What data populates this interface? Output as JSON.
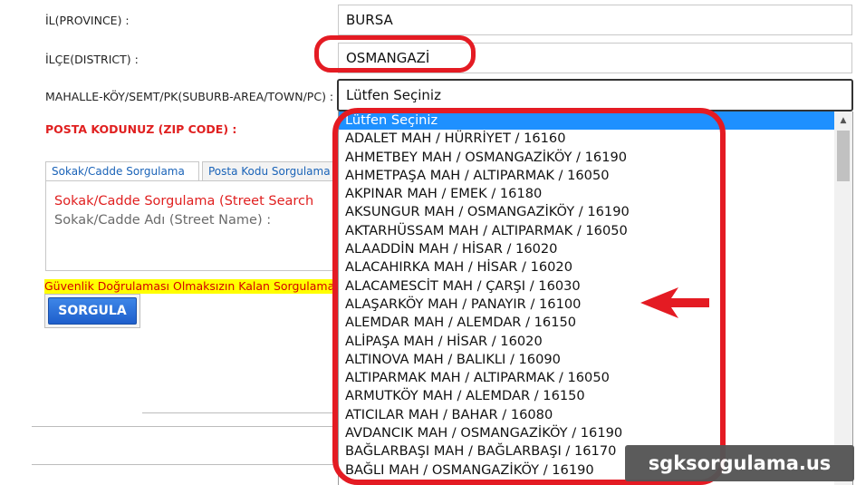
{
  "form": {
    "province_label": "İL(PROVINCE) :",
    "province_value": "BURSA",
    "district_label": "İLÇE(DISTRICT) :",
    "district_value": "OSMANGAZİ",
    "neighborhood_label": "MAHALLE-KÖY/SEMT/PK(SUBURB-AREA/TOWN/PC) :",
    "neighborhood_value": "Lütfen Seçiniz",
    "zip_label": "POSTA KODUNUZ (ZIP CODE) :"
  },
  "tabs": [
    {
      "label": "Sokak/Cadde Sorgulama",
      "active": true
    },
    {
      "label": "Posta Kodu Sorgulama",
      "active": false
    }
  ],
  "panel": {
    "title": "Sokak/Cadde Sorgulama (Street Search",
    "subtitle": "Sokak/Cadde Adı (Street Name) :"
  },
  "warning": "Güvenlik Doğrulaması Olmaksızın Kalan Sorgulama H",
  "search_button": "SORGULA",
  "dropdown": {
    "options": [
      "Lütfen Seçiniz",
      "ADALET MAH / HÜRRİYET / 16160",
      "AHMETBEY MAH / OSMANGAZİKÖY / 16190",
      "AHMETPAŞA MAH / ALTIPARMAK / 16050",
      "AKPINAR MAH / EMEK / 16180",
      "AKSUNGUR MAH / OSMANGAZİKÖY / 16190",
      "AKTARHÜSSAM MAH / ALTIPARMAK / 16050",
      "ALAADDİN MAH / HİSAR / 16020",
      "ALACAHIRKA MAH / HİSAR / 16020",
      "ALACAMESCİT MAH / ÇARŞI / 16030",
      "ALAŞARKÖY MAH / PANAYIR / 16100",
      "ALEMDAR MAH / ALEMDAR / 16150",
      "ALİPAŞA MAH / HİSAR / 16020",
      "ALTINOVA MAH / BALIKLI / 16090",
      "ALTIPARMAK MAH / ALTIPARMAK / 16050",
      "ARMUTKÖY MAH / ALEMDAR / 16150",
      "ATICILAR MAH / BAHAR / 16080",
      "AVDANCIK MAH / OSMANGAZİKÖY / 16190",
      "BAĞLARBAŞI MAH / BAĞLARBAŞI / 16170",
      "BAĞLI MAH / OSMANGAZİKÖY / 16190"
    ],
    "selected_index": 0
  },
  "watermark": "sgksorgulama.us",
  "colors": {
    "annotation_red": "#e41b23",
    "selected_blue": "#1e90ff",
    "zip_red": "#e02020",
    "warning_yellow": "#ffff00",
    "button_blue": "#2a6fd8"
  },
  "icons": {
    "scroll_up": "triangle-up",
    "annotation_arrow": "arrow-left"
  }
}
